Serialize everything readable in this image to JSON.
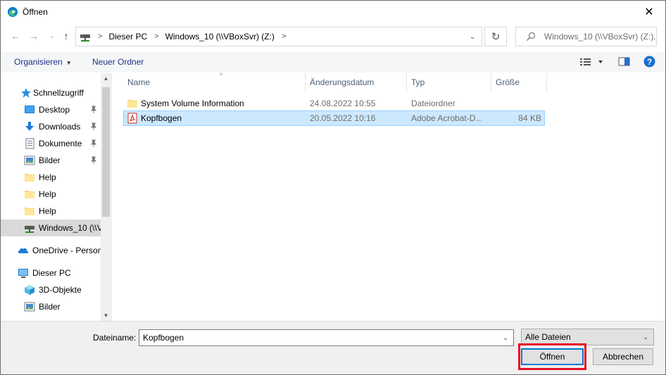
{
  "window": {
    "title": "Öffnen",
    "close_glyph": "✕"
  },
  "nav": {
    "breadcrumb": [
      "Dieser PC",
      "Windows_10 (\\\\VBoxSvr) (Z:)"
    ],
    "search_placeholder": "Windows_10 (\\\\VBoxSvr) (Z:)..."
  },
  "toolbar": {
    "organize": "Organisieren",
    "new_folder": "Neuer Ordner"
  },
  "sidebar": {
    "items": [
      {
        "label": "Schnellzugriff",
        "icon": "star-icon",
        "pinned": false
      },
      {
        "label": "Desktop",
        "icon": "desktop-icon",
        "pinned": true
      },
      {
        "label": "Downloads",
        "icon": "download-icon",
        "pinned": true
      },
      {
        "label": "Dokumente",
        "icon": "document-icon",
        "pinned": true
      },
      {
        "label": "Bilder",
        "icon": "pictures-icon",
        "pinned": true
      },
      {
        "label": "Help",
        "icon": "folder-icon",
        "pinned": false
      },
      {
        "label": "Help",
        "icon": "folder-icon",
        "pinned": false
      },
      {
        "label": "Help",
        "icon": "folder-icon",
        "pinned": false
      },
      {
        "label": "Windows_10 (\\\\V",
        "icon": "network-drive-icon",
        "pinned": false,
        "selected": true
      },
      {
        "label": "OneDrive - Person",
        "icon": "onedrive-icon",
        "pinned": false
      },
      {
        "label": "Dieser PC",
        "icon": "pc-icon",
        "pinned": false
      },
      {
        "label": "3D-Objekte",
        "icon": "3d-objects-icon",
        "pinned": false
      },
      {
        "label": "Bilder",
        "icon": "pictures-icon",
        "pinned": false
      }
    ]
  },
  "columns": {
    "name": "Name",
    "date": "Änderungsdatum",
    "type": "Typ",
    "size": "Größe"
  },
  "files": [
    {
      "name": "System Volume Information",
      "date": "24.08.2022 10:55",
      "type": "Dateiordner",
      "size": "",
      "icon": "folder-icon"
    },
    {
      "name": "Kopfbogen",
      "date": "20.05.2022 10:16",
      "type": "Adobe Acrobat-D...",
      "size": "84 KB",
      "icon": "pdf-icon",
      "selected": true
    }
  ],
  "bottom": {
    "filename_label": "Dateiname:",
    "filename_value": "Kopfbogen",
    "filetype_value": "Alle Dateien",
    "open_button": "Öffnen",
    "cancel_button": "Abbrechen"
  }
}
